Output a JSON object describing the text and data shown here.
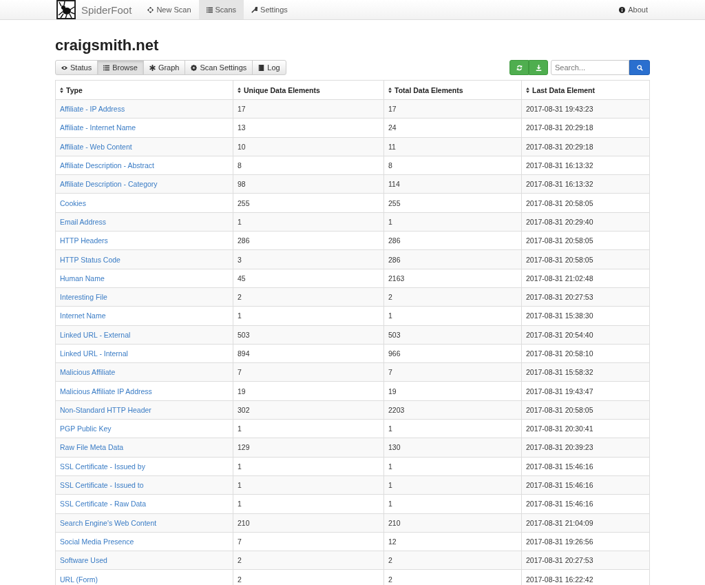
{
  "navbar": {
    "brand": "SpiderFoot",
    "items": [
      {
        "label": "New Scan",
        "selected": false
      },
      {
        "label": "Scans",
        "selected": true
      },
      {
        "label": "Settings",
        "selected": false
      }
    ],
    "about": "About"
  },
  "title": "craigsmith.net",
  "tabs": [
    {
      "label": "Status",
      "selected": false
    },
    {
      "label": "Browse",
      "selected": true
    },
    {
      "label": "Graph",
      "selected": false
    },
    {
      "label": "Scan Settings",
      "selected": false
    },
    {
      "label": "Log",
      "selected": false
    }
  ],
  "search": {
    "placeholder": "Search..."
  },
  "table": {
    "columns": [
      "Type",
      "Unique Data Elements",
      "Total Data Elements",
      "Last Data Element"
    ],
    "rows": [
      [
        "Affiliate - IP Address",
        "17",
        "17",
        "2017-08-31 19:43:23"
      ],
      [
        "Affiliate - Internet Name",
        "13",
        "24",
        "2017-08-31 20:29:18"
      ],
      [
        "Affiliate - Web Content",
        "10",
        "11",
        "2017-08-31 20:29:18"
      ],
      [
        "Affiliate Description - Abstract",
        "8",
        "8",
        "2017-08-31 16:13:32"
      ],
      [
        "Affiliate Description - Category",
        "98",
        "114",
        "2017-08-31 16:13:32"
      ],
      [
        "Cookies",
        "255",
        "255",
        "2017-08-31 20:58:05"
      ],
      [
        "Email Address",
        "1",
        "1",
        "2017-08-31 20:29:40"
      ],
      [
        "HTTP Headers",
        "286",
        "286",
        "2017-08-31 20:58:05"
      ],
      [
        "HTTP Status Code",
        "3",
        "286",
        "2017-08-31 20:58:05"
      ],
      [
        "Human Name",
        "45",
        "2163",
        "2017-08-31 21:02:48"
      ],
      [
        "Interesting File",
        "2",
        "2",
        "2017-08-31 20:27:53"
      ],
      [
        "Internet Name",
        "1",
        "1",
        "2017-08-31 15:38:30"
      ],
      [
        "Linked URL - External",
        "503",
        "503",
        "2017-08-31 20:54:40"
      ],
      [
        "Linked URL - Internal",
        "894",
        "966",
        "2017-08-31 20:58:10"
      ],
      [
        "Malicious Affiliate",
        "7",
        "7",
        "2017-08-31 15:58:32"
      ],
      [
        "Malicious Affiliate IP Address",
        "19",
        "19",
        "2017-08-31 19:43:47"
      ],
      [
        "Non-Standard HTTP Header",
        "302",
        "2203",
        "2017-08-31 20:58:05"
      ],
      [
        "PGP Public Key",
        "1",
        "1",
        "2017-08-31 20:30:41"
      ],
      [
        "Raw File Meta Data",
        "129",
        "130",
        "2017-08-31 20:39:23"
      ],
      [
        "SSL Certificate - Issued by",
        "1",
        "1",
        "2017-08-31 15:46:16"
      ],
      [
        "SSL Certificate - Issued to",
        "1",
        "1",
        "2017-08-31 15:46:16"
      ],
      [
        "SSL Certificate - Raw Data",
        "1",
        "1",
        "2017-08-31 15:46:16"
      ],
      [
        "Search Engine's Web Content",
        "210",
        "210",
        "2017-08-31 21:04:09"
      ],
      [
        "Social Media Presence",
        "7",
        "12",
        "2017-08-31 19:26:56"
      ],
      [
        "Software Used",
        "2",
        "2",
        "2017-08-31 20:27:53"
      ],
      [
        "URL (Form)",
        "2",
        "2",
        "2017-08-31 16:22:42"
      ]
    ]
  }
}
